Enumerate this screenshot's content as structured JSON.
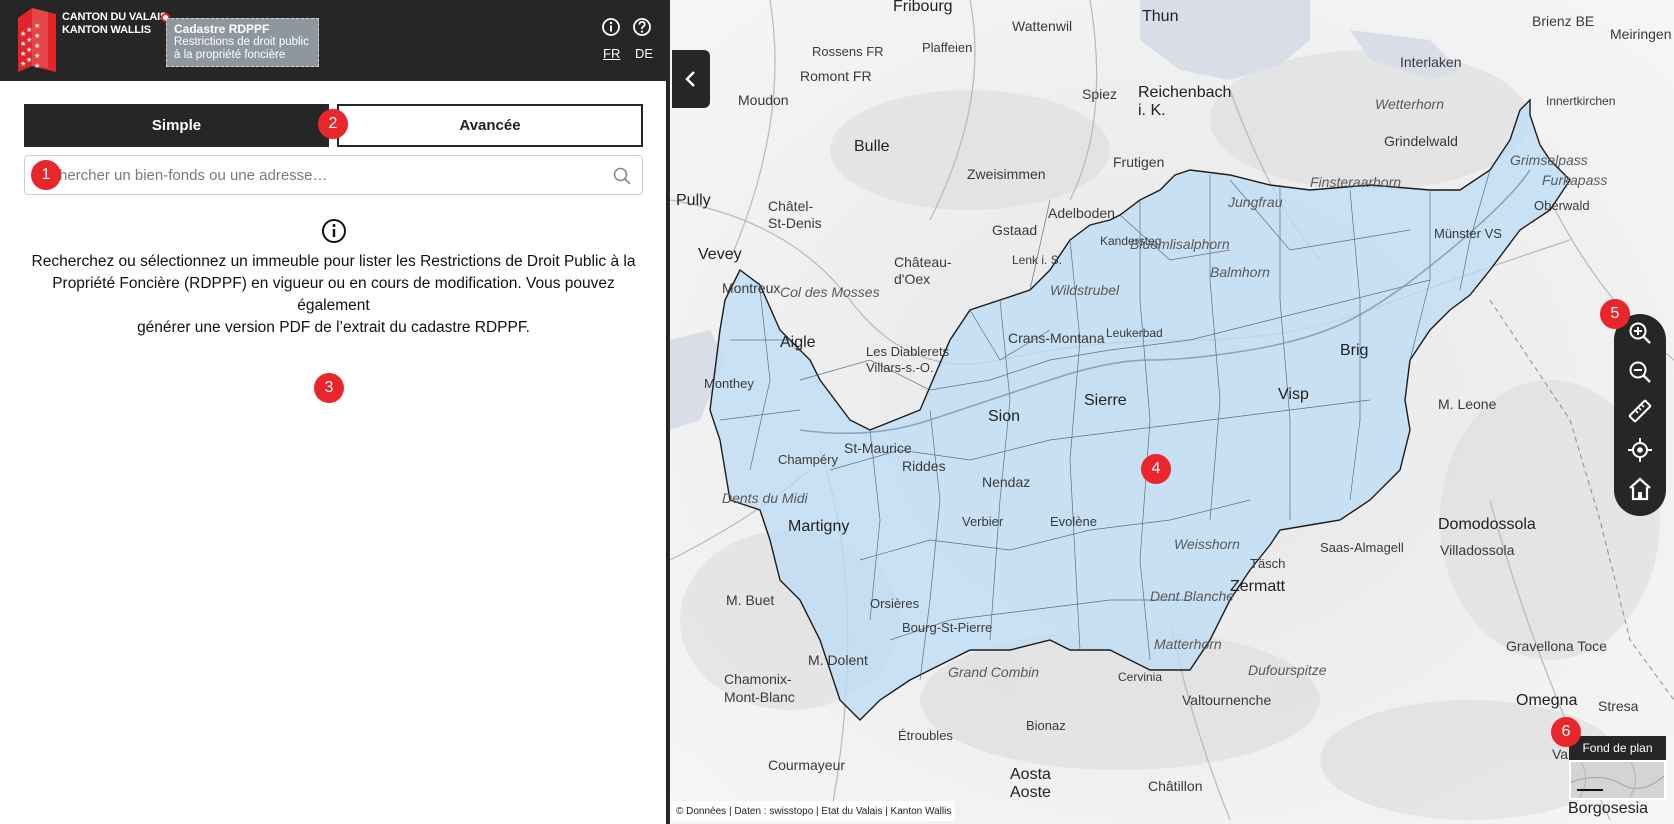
{
  "header": {
    "canton_line1": "CANTON DU VALAIS",
    "canton_line2": "KANTON WALLIS",
    "app_title": "Cadastre RDPPF",
    "app_subtitle_line1": "Restrictions de droit public",
    "app_subtitle_line2": "à la propriété foncière",
    "lang_fr": "FR",
    "lang_de": "DE",
    "info_icon": "info-icon",
    "help_icon": "help-icon"
  },
  "tabs": {
    "simple": "Simple",
    "advanced": "Avancée"
  },
  "search": {
    "placeholder": "hercher un bien-fonds ou une adresse…"
  },
  "info": {
    "line1": "Recherchez ou sélectionnez un immeuble pour lister les Restrictions de Droit Public à la",
    "line2": "Propriété Foncière (RDPPF) en vigueur ou en cours de modification. Vous pouvez également",
    "line3": "générer une version PDF de l’extrait du cadastre RDPPF."
  },
  "markers": [
    "1",
    "2",
    "3",
    "4",
    "5",
    "6"
  ],
  "map": {
    "basemap_label": "Fond de plan",
    "attribution": "© Données | Daten : swisstopo | Etat du Valais | Kanton Wallis",
    "places": [
      "Fribourg",
      "Thun",
      "Brienz BE",
      "Meiringen",
      "Innertkirchen",
      "Interlaken",
      "Wattenwil",
      "Plaffeien",
      "Rossens FR",
      "Romont FR",
      "Moudon",
      "Bulle",
      "Spiez",
      "Reichenbach i. K.",
      "Frutigen",
      "Grindelwald",
      "Wetterhorn",
      "Zweisimmen",
      "Adelboden",
      "Gstaad",
      "Lenk i. S.",
      "Kandersteg",
      "Bluemlisalphorn",
      "Balmhorn",
      "Wildstrubel",
      "Château-d'Oex",
      "Col des Mosses",
      "Aigle",
      "Montreux",
      "Vevey",
      "Pully",
      "Châtel-St-Denis",
      "Les Diablerets",
      "Villars-s.-O.",
      "Sion",
      "Sierre",
      "Brig",
      "Visp",
      "Crans-Montana",
      "Leukerbad",
      "Martigny",
      "St-Maurice",
      "Riddes",
      "Nendaz",
      "Verbier",
      "Evolène",
      "Zermatt",
      "Täsch",
      "Saas-Almagell",
      "Weisshorn",
      "Dent Blanche",
      "Matterhorn",
      "Dufourspitze",
      "Grand Combin",
      "Domodossola",
      "Villadossola",
      "M. Leone",
      "Chamonix-Mont-Blanc",
      "Courmayeur",
      "Aosta Aoste",
      "Châtillon",
      "Valtournenche",
      "Omegna",
      "Varallo",
      "Borgosesia",
      "Monthey",
      "Champéry",
      "Dents du Midi",
      "Oberwald",
      "Münster VS",
      "Furkapass",
      "Grimselpass",
      "Finsteraarhorn",
      "Jungfrau",
      "M. Buet",
      "M. Dolent",
      "Étroubles",
      "Bionaz",
      "Cervinia",
      "Stresa",
      "Gravellona Toce",
      "Orsières",
      "Bourg-St-Pierre"
    ]
  },
  "colors": {
    "header_bg": "#262626",
    "marker_red": "#e8262b",
    "valais_fill": "#bcdcf7",
    "valais_stroke": "#1c1c1c"
  }
}
